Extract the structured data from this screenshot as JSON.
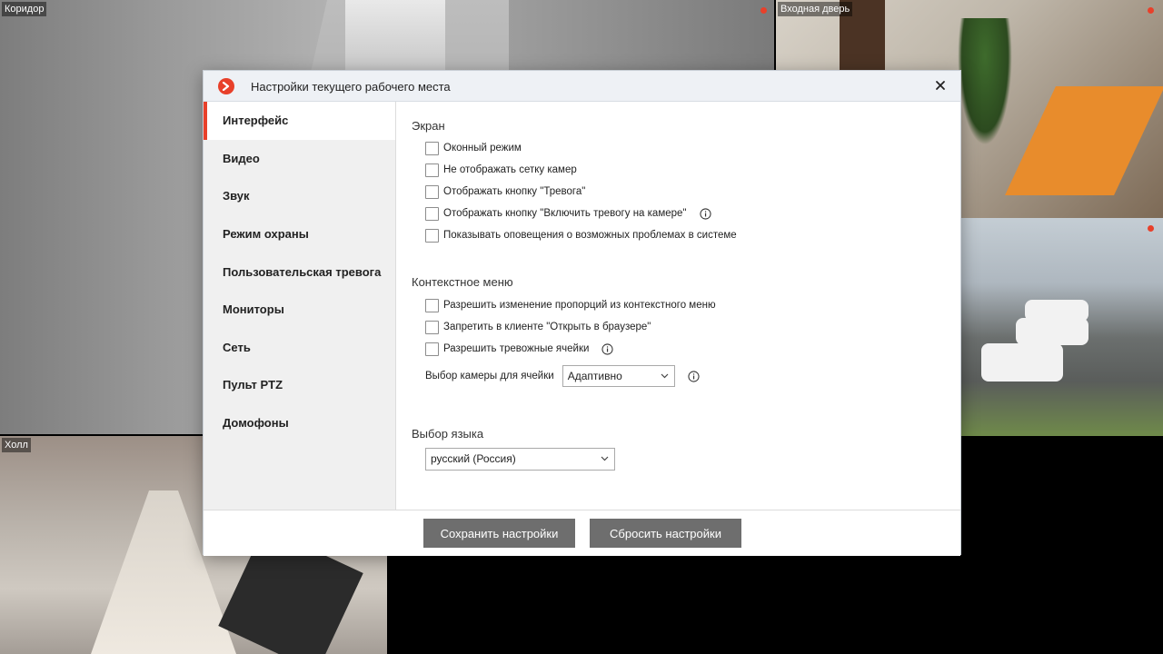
{
  "cameras": {
    "corridor": {
      "label": "Коридор"
    },
    "entrance": {
      "label": "Входная дверь"
    },
    "hall": {
      "label": "Холл"
    }
  },
  "dialog": {
    "title": "Настройки текущего рабочего места",
    "close_icon": "close-icon",
    "accent_color": "#e8402a"
  },
  "sidebar": {
    "items": [
      {
        "label": "Интерфейс",
        "active": true
      },
      {
        "label": "Видео"
      },
      {
        "label": "Звук"
      },
      {
        "label": "Режим охраны"
      },
      {
        "label": "Пользовательская тревога"
      },
      {
        "label": "Мониторы"
      },
      {
        "label": "Сеть"
      },
      {
        "label": "Пульт PTZ"
      },
      {
        "label": "Домофоны"
      }
    ]
  },
  "screen_section": {
    "title": "Экран",
    "options": [
      {
        "label": "Оконный режим",
        "checked": false
      },
      {
        "label": "Не отображать сетку камер",
        "checked": false
      },
      {
        "label": "Отображать кнопку \"Тревога\"",
        "checked": false
      },
      {
        "label": "Отображать кнопку \"Включить тревогу на камере\"",
        "checked": false,
        "info": true
      },
      {
        "label": "Показывать оповещения о возможных проблемах в системе",
        "checked": false
      }
    ]
  },
  "context_section": {
    "title": "Контекстное меню",
    "options": [
      {
        "label": "Разрешить изменение пропорций из контекстного меню",
        "checked": false
      },
      {
        "label": "Запретить в клиенте \"Открыть в браузере\"",
        "checked": false
      },
      {
        "label": "Разрешить тревожные ячейки",
        "checked": false,
        "info": true
      }
    ],
    "camera_select_label": "Выбор камеры для ячейки",
    "camera_select_value": "Адаптивно"
  },
  "language_section": {
    "title": "Выбор языка",
    "value": "русский (Россия)"
  },
  "footer": {
    "save_label": "Сохранить настройки",
    "reset_label": "Сбросить настройки"
  }
}
